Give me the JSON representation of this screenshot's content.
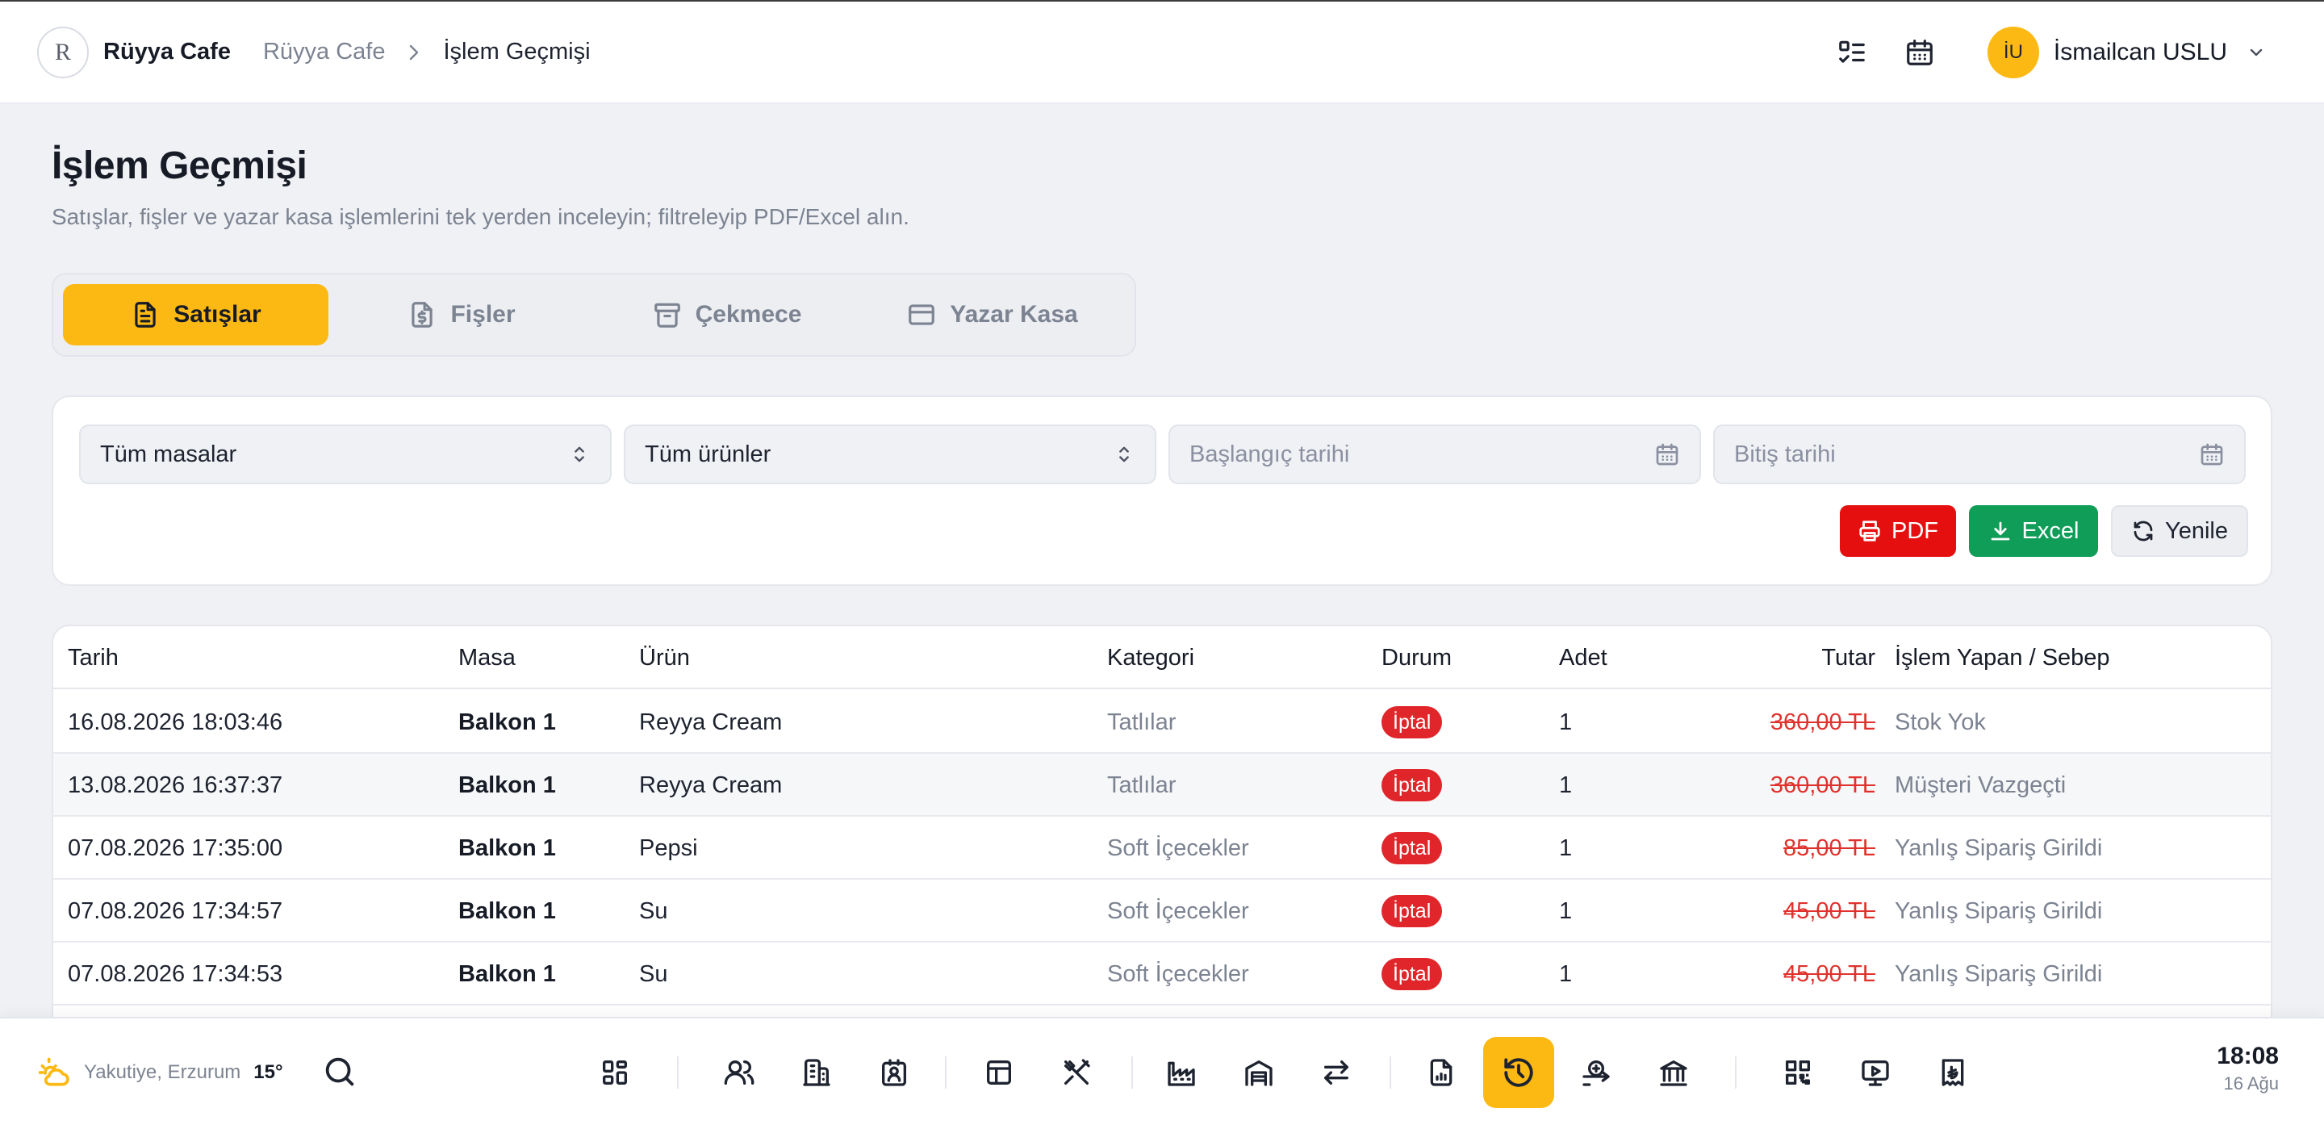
{
  "header": {
    "brand_name": "Rüyya Cafe",
    "logo_text": "R",
    "breadcrumb": [
      "Rüyya Cafe",
      "İşlem Geçmişi"
    ],
    "user_initials": "İU",
    "user_name": "İsmailcan USLU"
  },
  "page": {
    "title": "İşlem Geçmişi",
    "subtitle": "Satışlar, fişler ve yazar kasa işlemlerini tek yerden inceleyin; filtreleyip PDF/Excel alın."
  },
  "tabs": [
    {
      "label": "Satışlar",
      "icon": "document-icon",
      "active": true
    },
    {
      "label": "Fişler",
      "icon": "receipt-icon",
      "active": false
    },
    {
      "label": "Çekmece",
      "icon": "archive-icon",
      "active": false
    },
    {
      "label": "Yazar Kasa",
      "icon": "credit-card-icon",
      "active": false
    }
  ],
  "filters": {
    "table_select": "Tüm masalar",
    "product_select": "Tüm ürünler",
    "start_date_placeholder": "Başlangıç tarihi",
    "end_date_placeholder": "Bitiş tarihi"
  },
  "actions": {
    "pdf": "PDF",
    "excel": "Excel",
    "refresh": "Yenile"
  },
  "table": {
    "headers": {
      "date": "Tarih",
      "table": "Masa",
      "product": "Ürün",
      "category": "Kategori",
      "status": "Durum",
      "qty": "Adet",
      "amount": "Tutar",
      "user": "İşlem Yapan / Sebep"
    },
    "rows": [
      {
        "date": "16.08.2026 18:03:46",
        "table": "Balkon 1",
        "product": "Reyya Cream",
        "category": "Tatlılar",
        "status": "İptal",
        "qty": "1",
        "amount": "360,00 TL",
        "user": "Stok Yok"
      },
      {
        "date": "13.08.2026 16:37:37",
        "table": "Balkon 1",
        "product": "Reyya Cream",
        "category": "Tatlılar",
        "status": "İptal",
        "qty": "1",
        "amount": "360,00 TL",
        "user": "Müşteri Vazgeçti"
      },
      {
        "date": "07.08.2026 17:35:00",
        "table": "Balkon 1",
        "product": "Pepsi",
        "category": "Soft İçecekler",
        "status": "İptal",
        "qty": "1",
        "amount": "85,00 TL",
        "user": "Yanlış Sipariş Girildi"
      },
      {
        "date": "07.08.2026 17:34:57",
        "table": "Balkon 1",
        "product": "Su",
        "category": "Soft İçecekler",
        "status": "İptal",
        "qty": "1",
        "amount": "45,00 TL",
        "user": "Yanlış Sipariş Girildi"
      },
      {
        "date": "07.08.2026 17:34:53",
        "table": "Balkon 1",
        "product": "Su",
        "category": "Soft İçecekler",
        "status": "İptal",
        "qty": "1",
        "amount": "45,00 TL",
        "user": "Yanlış Sipariş Girildi"
      }
    ]
  },
  "dock": {
    "weather_location": "Yakutiye, Erzurum",
    "weather_temp": "15°",
    "clock_time": "18:08",
    "clock_date": "16 Ağu",
    "active_item": "history-icon"
  },
  "colors": {
    "accent": "#fdb913",
    "danger": "#e60f0f",
    "success": "#0f9d58",
    "background": "#eff1f5"
  }
}
